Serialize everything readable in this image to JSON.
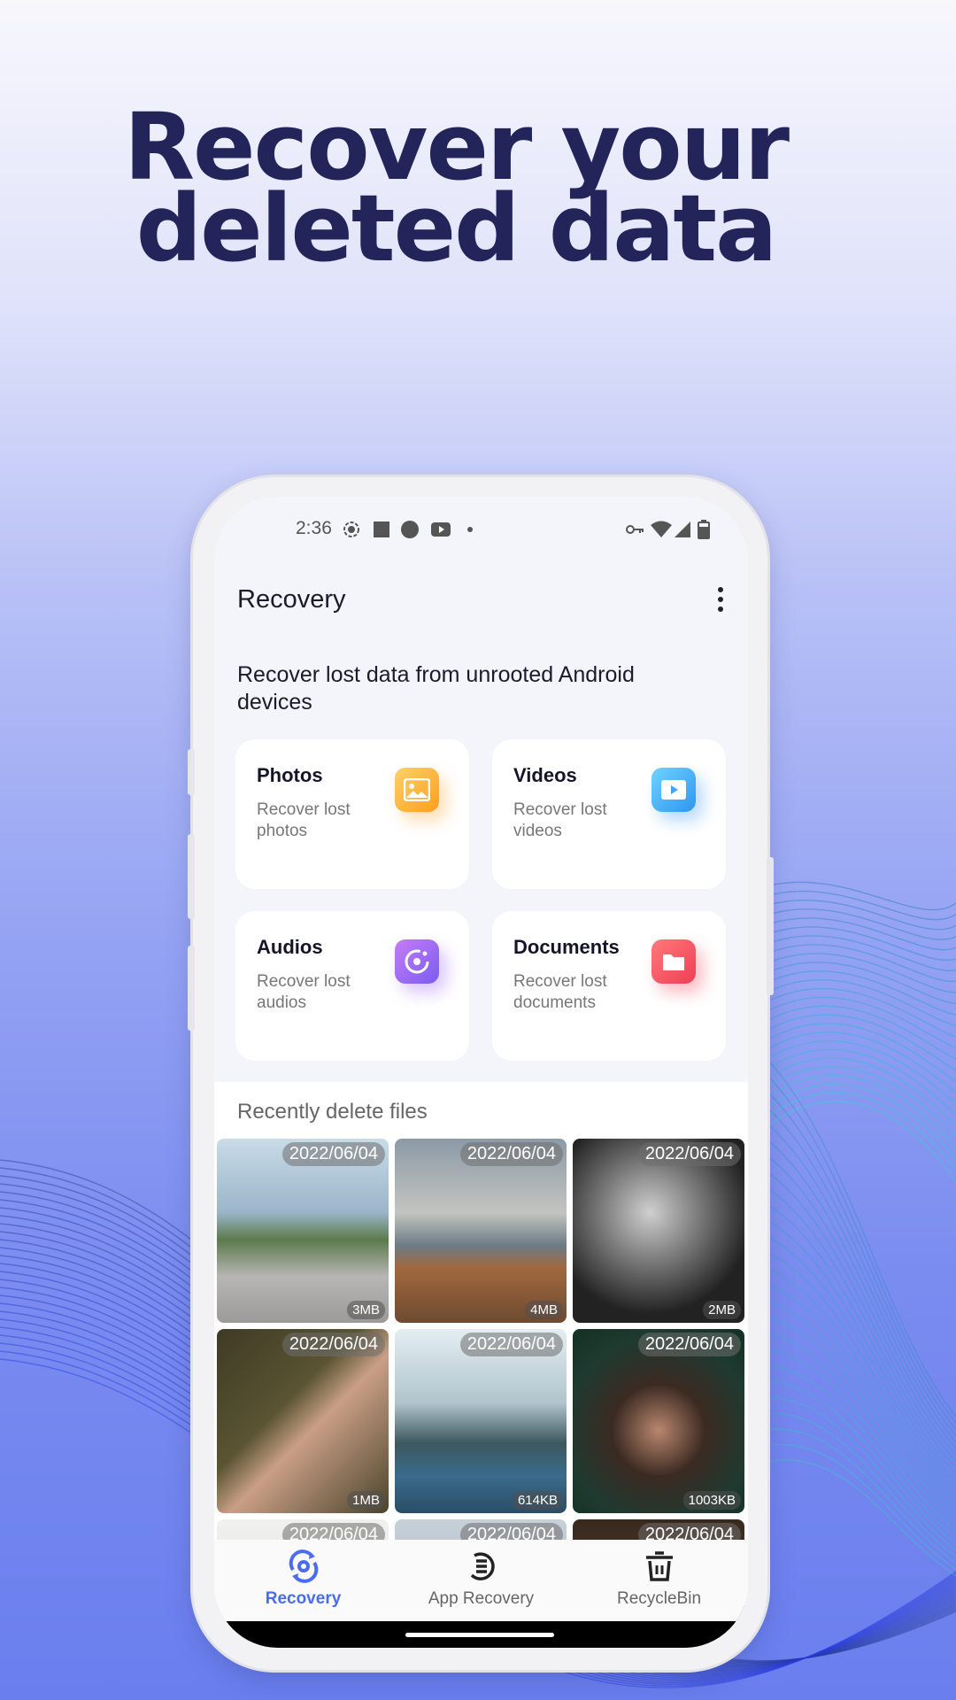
{
  "headline": [
    "Recover your",
    "deleted data"
  ],
  "status_bar": {
    "time": "2:36",
    "icons": [
      "screen-record-icon",
      "square-icon",
      "circle-icon",
      "youtube-icon",
      "dot-icon",
      "vpn-key-icon",
      "wifi-icon",
      "signal-icon",
      "battery-icon"
    ]
  },
  "app_bar": {
    "title": "Recovery",
    "menu_icon": "more-vertical-icon"
  },
  "subtitle": "Recover lost data from unrooted Android devices",
  "categories": [
    {
      "title": "Photos",
      "desc": "Recover lost photos",
      "icon": "image-icon",
      "color": "#ffb13c"
    },
    {
      "title": "Videos",
      "desc": "Recover lost videos",
      "icon": "play-icon",
      "color": "#3fb0f5"
    },
    {
      "title": "Audios",
      "desc": "Recover lost audios",
      "icon": "music-disc-icon",
      "color": "#9a6cf5"
    },
    {
      "title": "Documents",
      "desc": "Recover lost documents",
      "icon": "folder-icon",
      "color": "#f3505e"
    }
  ],
  "recent": {
    "title": "Recently delete files",
    "files": [
      {
        "date": "2022/06/04",
        "size": "3MB"
      },
      {
        "date": "2022/06/04",
        "size": "4MB"
      },
      {
        "date": "2022/06/04",
        "size": "2MB"
      },
      {
        "date": "2022/06/04",
        "size": "1MB"
      },
      {
        "date": "2022/06/04",
        "size": "614KB"
      },
      {
        "date": "2022/06/04",
        "size": "1003KB"
      },
      {
        "date": "2022/06/04"
      },
      {
        "date": "2022/06/04"
      },
      {
        "date": "2022/06/04"
      }
    ]
  },
  "bottom_nav": [
    {
      "label": "Recovery",
      "icon": "recovery-icon",
      "active": true
    },
    {
      "label": "App Recovery",
      "icon": "app-list-icon"
    },
    {
      "label": "RecycleBin",
      "icon": "trash-icon"
    }
  ],
  "colors": {
    "accent": "#4a6cf0",
    "headline": "#22245a"
  }
}
